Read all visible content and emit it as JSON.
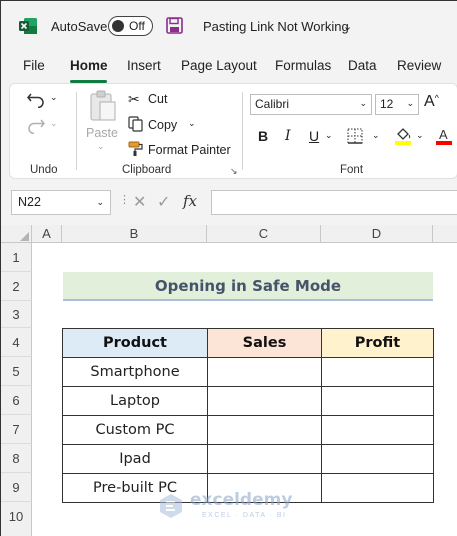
{
  "titlebar": {
    "autosave_label": "AutoSave",
    "toggle_state": "Off",
    "document_title": "Pasting Link Not Working"
  },
  "tabs": [
    "File",
    "Home",
    "Insert",
    "Page Layout",
    "Formulas",
    "Data",
    "Review"
  ],
  "active_tab": "Home",
  "ribbon": {
    "undo_group": "Undo",
    "clipboard": {
      "paste": "Paste",
      "cut": "Cut",
      "copy": "Copy",
      "format_painter": "Format Painter",
      "label": "Clipboard"
    },
    "font": {
      "family": "Calibri",
      "size": "12",
      "label": "Font",
      "bold": "B",
      "italic": "I",
      "underline": "U",
      "highlight_color": "#ffff00",
      "font_color": "#ff0000"
    }
  },
  "formula_bar": {
    "name_box": "N22",
    "fx": "fx",
    "value": ""
  },
  "grid": {
    "columns": [
      "A",
      "B",
      "C",
      "D"
    ],
    "rows": [
      "1",
      "2",
      "3",
      "4",
      "5",
      "6",
      "7",
      "8",
      "9",
      "10"
    ],
    "section_title": "Opening in Safe Mode",
    "table": {
      "headers": [
        "Product",
        "Sales",
        "Profit"
      ],
      "rows": [
        [
          "Smartphone",
          "",
          ""
        ],
        [
          "Laptop",
          "",
          ""
        ],
        [
          "Custom PC",
          "",
          ""
        ],
        [
          "Ipad",
          "",
          ""
        ],
        [
          "Pre-built PC",
          "",
          ""
        ]
      ]
    }
  },
  "watermark": {
    "name": "exceldemy",
    "tagline": "EXCEL · DATA · BI"
  },
  "colors": {
    "excel_green": "#107c41",
    "title_fill": "#e2efda",
    "product_header": "#ddebf7",
    "sales_header": "#fce4d6",
    "profit_header": "#fff2cc"
  }
}
